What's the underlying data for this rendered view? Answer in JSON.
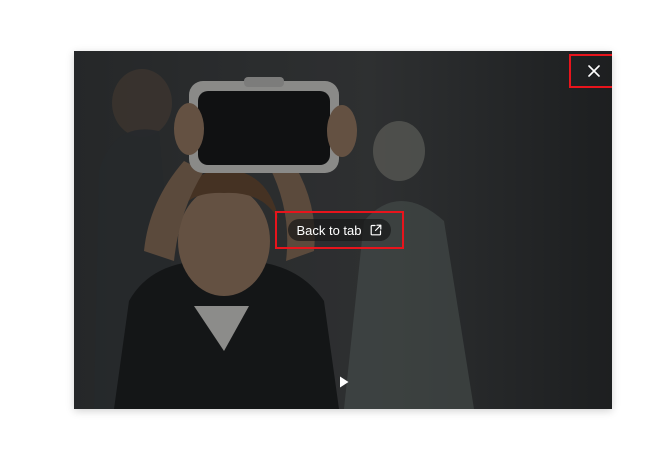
{
  "pip": {
    "back_to_tab_label": "Back to tab",
    "icons": {
      "close": "close-icon",
      "open_in_tab": "external-link-icon",
      "play": "play-icon"
    }
  },
  "colors": {
    "highlight": "#e8141c",
    "overlay_text": "#ffffff",
    "pill_background": "#191919"
  }
}
